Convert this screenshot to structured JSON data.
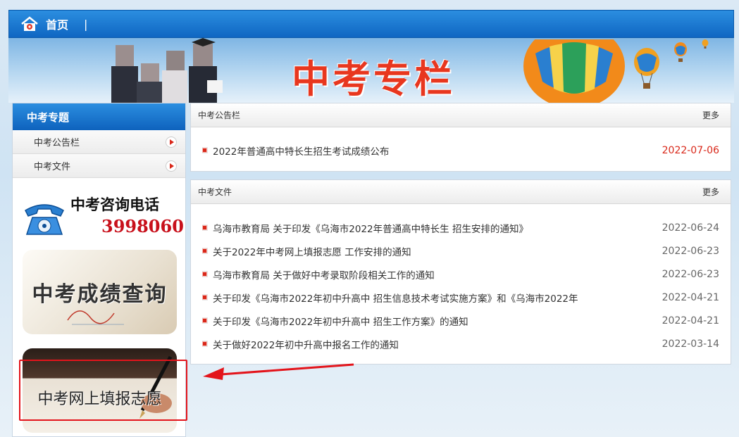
{
  "nav": {
    "home_label": "首页",
    "separator": "|"
  },
  "banner": {
    "title": "中考专栏"
  },
  "sidebar": {
    "heading": "中考专题",
    "items": [
      {
        "label": "中考公告栏"
      },
      {
        "label": "中考文件"
      }
    ],
    "hotline": {
      "title": "中考咨询电话",
      "number": "3998060"
    },
    "tiles": {
      "score_query": "中考成绩查询",
      "online_apply": "中考网上填报志愿"
    }
  },
  "notice_panel": {
    "title": "中考公告栏",
    "more": "更多",
    "items": [
      {
        "text": "2022年普通高中特长生招生考试成绩公布",
        "date": "2022-07-06"
      }
    ]
  },
  "docs_panel": {
    "title": "中考文件",
    "more": "更多",
    "items": [
      {
        "text": "乌海市教育局 关于印发《乌海市2022年普通高中特长生 招生安排的通知》",
        "date": "2022-06-24"
      },
      {
        "text": "关于2022年中考网上填报志愿 工作安排的通知",
        "date": "2022-06-23"
      },
      {
        "text": "乌海市教育局 关于做好中考录取阶段相关工作的通知",
        "date": "2022-06-23"
      },
      {
        "text": "关于印发《乌海市2022年初中升高中 招生信息技术考试实施方案》和《乌海市2022年",
        "date": "2022-04-21"
      },
      {
        "text": "关于印发《乌海市2022年初中升高中 招生工作方案》的通知",
        "date": "2022-04-21"
      },
      {
        "text": "关于做好2022年初中升高中报名工作的通知",
        "date": "2022-03-14"
      }
    ]
  },
  "colors": {
    "nav_blue": "#1677d2",
    "accent_red": "#d9281a",
    "annotation_red": "#e3141b"
  }
}
